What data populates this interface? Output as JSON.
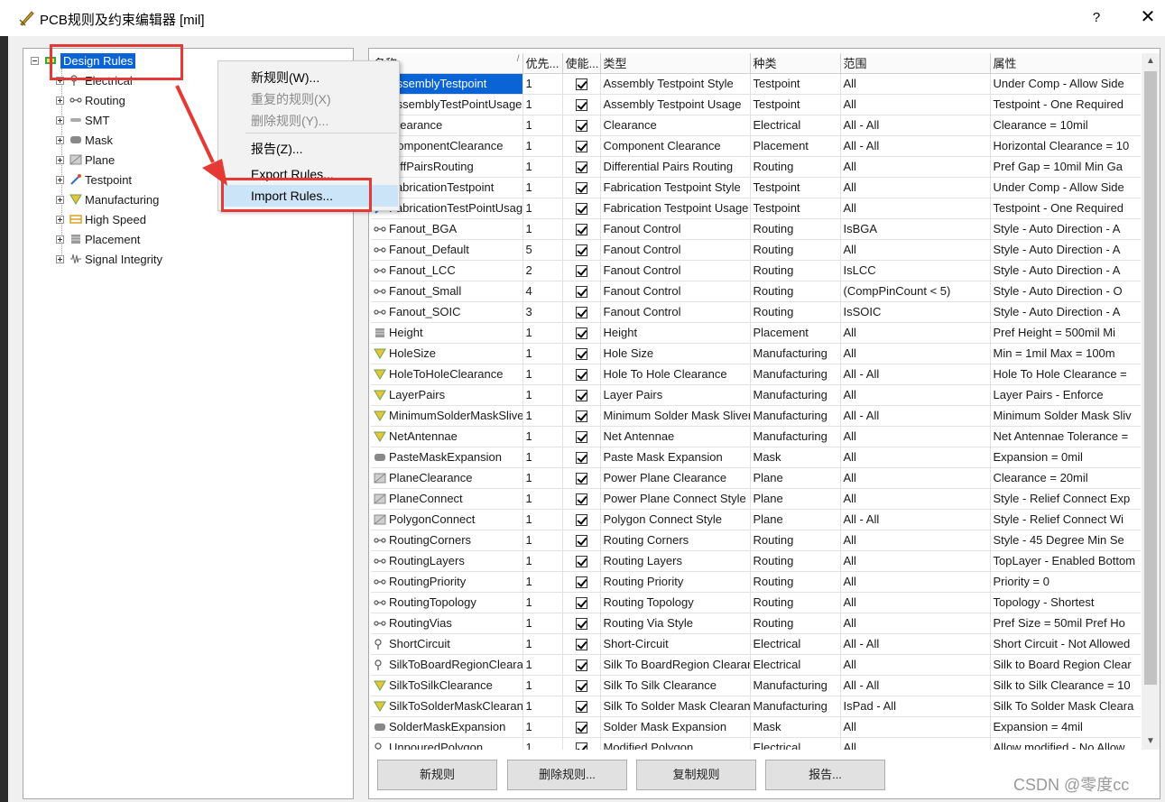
{
  "window": {
    "title": "PCB规则及约束编辑器 [mil]",
    "help": "?",
    "close": "✕"
  },
  "tree": {
    "root": "Design Rules",
    "items": [
      "Electrical",
      "Routing",
      "SMT",
      "Mask",
      "Plane",
      "Testpoint",
      "Manufacturing",
      "High Speed",
      "Placement",
      "Signal Integrity"
    ]
  },
  "context_menu": {
    "items": [
      {
        "label": "新规则(W)...",
        "enabled": true
      },
      {
        "label": "重复的规则(X)",
        "enabled": false
      },
      {
        "label": "删除规则(Y)...",
        "enabled": false
      },
      {
        "label": "报告(Z)...",
        "enabled": true
      },
      {
        "label": "Export Rules...",
        "enabled": true
      },
      {
        "label": "Import Rules...",
        "enabled": true
      }
    ]
  },
  "table": {
    "columns": [
      "名称",
      "优先...",
      "使能...",
      "类型",
      "种类",
      "范围",
      "属性"
    ],
    "rows": [
      {
        "name": "AssemblyTestpoint",
        "icon": "testpoint",
        "pri": "1",
        "type": "Assembly Testpoint Style",
        "kind": "Testpoint",
        "scope": "All",
        "attr": "Under Comp - Allow    Side"
      },
      {
        "name": "AssemblyTestPointUsage",
        "icon": "testpoint",
        "pri": "1",
        "type": "Assembly Testpoint Usage",
        "kind": "Testpoint",
        "scope": "All",
        "attr": "Testpoint - One Required"
      },
      {
        "name": "Clearance",
        "icon": "electrical",
        "pri": "1",
        "type": "Clearance",
        "kind": "Electrical",
        "scope": "All    -    All",
        "attr": "Clearance = 10mil"
      },
      {
        "name": "ComponentClearance",
        "icon": "placement",
        "pri": "1",
        "type": "Component Clearance",
        "kind": "Placement",
        "scope": "All    -    All",
        "attr": "Horizontal Clearance = 10"
      },
      {
        "name": "DiffPairsRouting",
        "icon": "routing",
        "pri": "1",
        "type": "Differential Pairs Routing",
        "kind": "Routing",
        "scope": "All",
        "attr": "Pref Gap = 10mil    Min Ga"
      },
      {
        "name": "FabricationTestpoint",
        "icon": "testpoint",
        "pri": "1",
        "type": "Fabrication Testpoint Style",
        "kind": "Testpoint",
        "scope": "All",
        "attr": "Under Comp - Allow    Side"
      },
      {
        "name": "FabricationTestPointUsage",
        "icon": "testpoint",
        "pri": "1",
        "type": "Fabrication Testpoint Usage",
        "kind": "Testpoint",
        "scope": "All",
        "attr": "Testpoint - One Required"
      },
      {
        "name": "Fanout_BGA",
        "icon": "routing",
        "pri": "1",
        "type": "Fanout Control",
        "kind": "Routing",
        "scope": "IsBGA",
        "attr": "Style - Auto    Direction - A"
      },
      {
        "name": "Fanout_Default",
        "icon": "routing",
        "pri": "5",
        "type": "Fanout Control",
        "kind": "Routing",
        "scope": "All",
        "attr": "Style - Auto    Direction - A"
      },
      {
        "name": "Fanout_LCC",
        "icon": "routing",
        "pri": "2",
        "type": "Fanout Control",
        "kind": "Routing",
        "scope": "IsLCC",
        "attr": "Style - Auto    Direction - A"
      },
      {
        "name": "Fanout_Small",
        "icon": "routing",
        "pri": "4",
        "type": "Fanout Control",
        "kind": "Routing",
        "scope": "(CompPinCount < 5)",
        "attr": "Style - Auto    Direction - O"
      },
      {
        "name": "Fanout_SOIC",
        "icon": "routing",
        "pri": "3",
        "type": "Fanout Control",
        "kind": "Routing",
        "scope": "IsSOIC",
        "attr": "Style - Auto    Direction - A"
      },
      {
        "name": "Height",
        "icon": "placement",
        "pri": "1",
        "type": "Height",
        "kind": "Placement",
        "scope": "All",
        "attr": "Pref Height = 500mil    Mi"
      },
      {
        "name": "HoleSize",
        "icon": "manufacturing",
        "pri": "1",
        "type": "Hole Size",
        "kind": "Manufacturing",
        "scope": "All",
        "attr": "Min = 1mil    Max = 100m"
      },
      {
        "name": "HoleToHoleClearance",
        "icon": "manufacturing",
        "pri": "1",
        "type": "Hole To Hole Clearance",
        "kind": "Manufacturing",
        "scope": "All    -    All",
        "attr": "Hole To Hole Clearance ="
      },
      {
        "name": "LayerPairs",
        "icon": "manufacturing",
        "pri": "1",
        "type": "Layer Pairs",
        "kind": "Manufacturing",
        "scope": "All",
        "attr": "Layer Pairs - Enforce"
      },
      {
        "name": "MinimumSolderMaskSliver",
        "icon": "manufacturing",
        "pri": "1",
        "type": "Minimum Solder Mask Sliver",
        "kind": "Manufacturing",
        "scope": "All    -    All",
        "attr": "Minimum Solder Mask Sliv"
      },
      {
        "name": "NetAntennae",
        "icon": "manufacturing",
        "pri": "1",
        "type": "Net Antennae",
        "kind": "Manufacturing",
        "scope": "All",
        "attr": "Net Antennae Tolerance ="
      },
      {
        "name": "PasteMaskExpansion",
        "icon": "mask",
        "pri": "1",
        "type": "Paste Mask Expansion",
        "kind": "Mask",
        "scope": "All",
        "attr": "Expansion = 0mil"
      },
      {
        "name": "PlaneClearance",
        "icon": "plane",
        "pri": "1",
        "type": "Power Plane Clearance",
        "kind": "Plane",
        "scope": "All",
        "attr": "Clearance = 20mil"
      },
      {
        "name": "PlaneConnect",
        "icon": "plane",
        "pri": "1",
        "type": "Power Plane Connect Style",
        "kind": "Plane",
        "scope": "All",
        "attr": "Style - Relief Connect    Exp"
      },
      {
        "name": "PolygonConnect",
        "icon": "plane",
        "pri": "1",
        "type": "Polygon Connect Style",
        "kind": "Plane",
        "scope": "All    -    All",
        "attr": "Style - Relief Connect    Wi"
      },
      {
        "name": "RoutingCorners",
        "icon": "routing",
        "pri": "1",
        "type": "Routing Corners",
        "kind": "Routing",
        "scope": "All",
        "attr": "Style - 45 Degree    Min Se"
      },
      {
        "name": "RoutingLayers",
        "icon": "routing",
        "pri": "1",
        "type": "Routing Layers",
        "kind": "Routing",
        "scope": "All",
        "attr": "TopLayer - Enabled Bottom"
      },
      {
        "name": "RoutingPriority",
        "icon": "routing",
        "pri": "1",
        "type": "Routing Priority",
        "kind": "Routing",
        "scope": "All",
        "attr": "Priority = 0"
      },
      {
        "name": "RoutingTopology",
        "icon": "routing",
        "pri": "1",
        "type": "Routing Topology",
        "kind": "Routing",
        "scope": "All",
        "attr": "Topology - Shortest"
      },
      {
        "name": "RoutingVias",
        "icon": "routing",
        "pri": "1",
        "type": "Routing Via Style",
        "kind": "Routing",
        "scope": "All",
        "attr": "Pref Size = 50mil    Pref Ho"
      },
      {
        "name": "ShortCircuit",
        "icon": "electrical",
        "pri": "1",
        "type": "Short-Circuit",
        "kind": "Electrical",
        "scope": "All    -    All",
        "attr": "Short Circuit - Not Allowed"
      },
      {
        "name": "SilkToBoardRegionClearance",
        "icon": "electrical",
        "pri": "1",
        "type": "Silk To BoardRegion Clearance",
        "kind": "Electrical",
        "scope": "All",
        "attr": "Silk to Board Region Clear"
      },
      {
        "name": "SilkToSilkClearance",
        "icon": "manufacturing",
        "pri": "1",
        "type": "Silk To Silk Clearance",
        "kind": "Manufacturing",
        "scope": "All    -    All",
        "attr": "Silk to Silk Clearance = 10"
      },
      {
        "name": "SilkToSolderMaskClearance",
        "icon": "manufacturing",
        "pri": "1",
        "type": "Silk To Solder Mask Clearance",
        "kind": "Manufacturing",
        "scope": "IsPad    -    All",
        "attr": "Silk To Solder Mask Cleara"
      },
      {
        "name": "SolderMaskExpansion",
        "icon": "mask",
        "pri": "1",
        "type": "Solder Mask Expansion",
        "kind": "Mask",
        "scope": "All",
        "attr": "Expansion = 4mil"
      },
      {
        "name": "UnpouredPolygon",
        "icon": "electrical",
        "pri": "1",
        "type": "Modified Polygon",
        "kind": "Electrical",
        "scope": "All",
        "attr": "Allow modified - No    Allow"
      }
    ]
  },
  "buttons": {
    "new_rule": "新规则",
    "delete_rule": "删除规则...",
    "copy_rule": "复制规则",
    "report": "报告..."
  },
  "watermark": "CSDN @零度cc",
  "colors": {
    "selection": "#0a64d6",
    "annotation": "#e53935",
    "menu_highlight": "#cce4f7"
  }
}
